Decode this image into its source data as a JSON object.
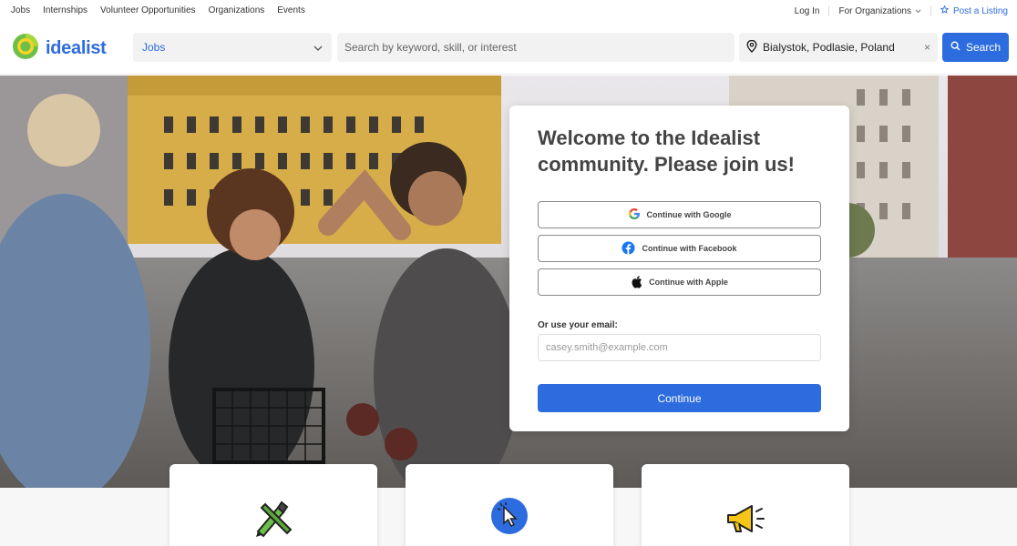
{
  "topbar": {
    "links": [
      "Jobs",
      "Internships",
      "Volunteer Opportunities",
      "Organizations",
      "Events"
    ],
    "login": "Log In",
    "for_orgs": "For Organizations",
    "post": "Post a Listing"
  },
  "header": {
    "logo_text": "idealist",
    "select_value": "Jobs",
    "keyword_placeholder": "Search by keyword, skill, or interest",
    "location_value": "Bialystok, Podlasie, Poland",
    "clear": "×",
    "search_label": "Search"
  },
  "card": {
    "title": "Welcome to the Idealist community. Please join us!",
    "google": "Continue with Google",
    "facebook": "Continue with Facebook",
    "apple": "Continue with Apple",
    "email_label": "Or use your email:",
    "email_placeholder": "casey.smith@example.com",
    "continue": "Continue"
  },
  "colors": {
    "brand": "#2d6cdf",
    "logo_green": "#6cc04a",
    "logo_yellow": "#f5d327"
  },
  "features": [
    {
      "icon": "ruler-pencil-icon"
    },
    {
      "icon": "cursor-click-icon"
    },
    {
      "icon": "megaphone-icon"
    }
  ]
}
